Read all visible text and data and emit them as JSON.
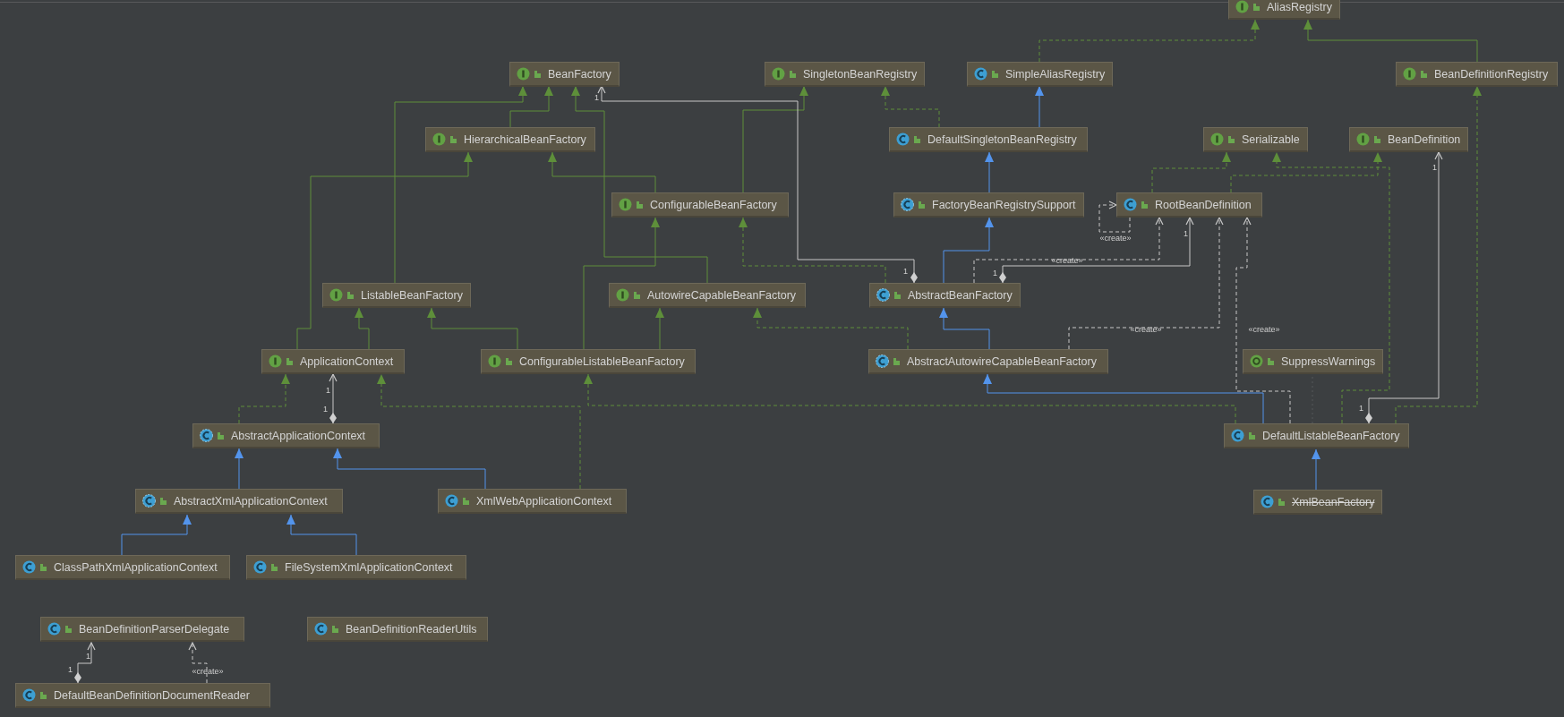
{
  "nodes": [
    {
      "name": "AliasRegistry",
      "kind": "interface",
      "deprecated": false
    },
    {
      "name": "BeanFactory",
      "kind": "interface",
      "deprecated": false
    },
    {
      "name": "SingletonBeanRegistry",
      "kind": "interface",
      "deprecated": false
    },
    {
      "name": "SimpleAliasRegistry",
      "kind": "class",
      "deprecated": false
    },
    {
      "name": "BeanDefinitionRegistry",
      "kind": "interface",
      "deprecated": false
    },
    {
      "name": "HierarchicalBeanFactory",
      "kind": "interface",
      "deprecated": false
    },
    {
      "name": "DefaultSingletonBeanRegistry",
      "kind": "class",
      "deprecated": false
    },
    {
      "name": "Serializable",
      "kind": "interface",
      "deprecated": false
    },
    {
      "name": "BeanDefinition",
      "kind": "interface",
      "deprecated": false
    },
    {
      "name": "ConfigurableBeanFactory",
      "kind": "interface",
      "deprecated": false
    },
    {
      "name": "FactoryBeanRegistrySupport",
      "kind": "abstract",
      "deprecated": false
    },
    {
      "name": "RootBeanDefinition",
      "kind": "class",
      "deprecated": false
    },
    {
      "name": "ListableBeanFactory",
      "kind": "interface",
      "deprecated": false
    },
    {
      "name": "AutowireCapableBeanFactory",
      "kind": "interface",
      "deprecated": false
    },
    {
      "name": "AbstractBeanFactory",
      "kind": "abstract",
      "deprecated": false
    },
    {
      "name": "ApplicationContext",
      "kind": "interface",
      "deprecated": false
    },
    {
      "name": "ConfigurableListableBeanFactory",
      "kind": "interface",
      "deprecated": false
    },
    {
      "name": "AbstractAutowireCapableBeanFactory",
      "kind": "abstract",
      "deprecated": false
    },
    {
      "name": "SuppressWarnings",
      "kind": "annotation",
      "deprecated": false
    },
    {
      "name": "AbstractApplicationContext",
      "kind": "abstract",
      "deprecated": false
    },
    {
      "name": "DefaultListableBeanFactory",
      "kind": "class",
      "deprecated": false
    },
    {
      "name": "AbstractXmlApplicationContext",
      "kind": "abstract",
      "deprecated": false
    },
    {
      "name": "XmlWebApplicationContext",
      "kind": "class",
      "deprecated": false
    },
    {
      "name": "XmlBeanFactory",
      "kind": "class",
      "deprecated": true
    },
    {
      "name": "ClassPathXmlApplicationContext",
      "kind": "class",
      "deprecated": false
    },
    {
      "name": "FileSystemXmlApplicationContext",
      "kind": "class",
      "deprecated": false
    },
    {
      "name": "BeanDefinitionParserDelegate",
      "kind": "class",
      "deprecated": false
    },
    {
      "name": "BeanDefinitionReaderUtils",
      "kind": "class",
      "deprecated": false
    },
    {
      "name": "DefaultBeanDefinitionDocumentReader",
      "kind": "class",
      "deprecated": false
    }
  ],
  "relations": [
    {
      "kind": "extends_interface"
    },
    {
      "kind": "extends_interface"
    },
    {
      "kind": "extends_interface"
    },
    {
      "kind": "extends_interface"
    },
    {
      "kind": "extends_interface"
    },
    {
      "kind": "extends_interface"
    },
    {
      "kind": "extends_interface"
    },
    {
      "kind": "extends_interface"
    },
    {
      "kind": "extends_interface"
    },
    {
      "kind": "extends_interface"
    },
    {
      "kind": "implements"
    },
    {
      "kind": "extends_interface"
    },
    {
      "kind": "extends_class"
    },
    {
      "kind": "implements"
    },
    {
      "kind": "extends_class"
    },
    {
      "kind": "extends_class"
    },
    {
      "kind": "implements"
    },
    {
      "kind": "association",
      "labels": [
        "1",
        "1"
      ]
    },
    {
      "kind": "association",
      "labels": [
        "1",
        "1"
      ]
    },
    {
      "kind": "create",
      "labels": [
        "«create»"
      ]
    },
    {
      "kind": "create",
      "labels": [
        "«create»"
      ]
    },
    {
      "kind": "implements"
    },
    {
      "kind": "implements"
    },
    {
      "kind": "extends_class"
    },
    {
      "kind": "implements"
    },
    {
      "kind": "create",
      "labels": [
        "«create»"
      ]
    },
    {
      "kind": "create",
      "labels": [
        "«create»"
      ]
    },
    {
      "kind": "implements"
    },
    {
      "kind": "association",
      "labels": [
        "1",
        "1"
      ]
    },
    {
      "kind": "implements"
    },
    {
      "kind": "extends_class"
    },
    {
      "kind": "implements"
    },
    {
      "kind": "annotated"
    },
    {
      "kind": "extends_class"
    },
    {
      "kind": "implements"
    },
    {
      "kind": "association",
      "labels": [
        "1",
        "1"
      ]
    },
    {
      "kind": "extends_class"
    },
    {
      "kind": "extends_class"
    },
    {
      "kind": "implements"
    },
    {
      "kind": "extends_class"
    },
    {
      "kind": "extends_class"
    },
    {
      "kind": "association",
      "labels": [
        "1",
        "1"
      ]
    },
    {
      "kind": "create",
      "labels": [
        "«create»"
      ]
    }
  ]
}
